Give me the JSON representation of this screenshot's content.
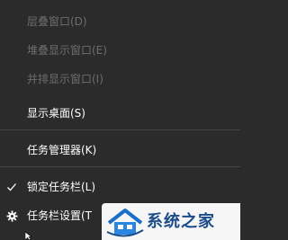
{
  "context_menu": {
    "items": [
      {
        "label": "层叠窗口(D)",
        "enabled": false
      },
      {
        "label": "堆叠显示窗口(E)",
        "enabled": false
      },
      {
        "label": "并排显示窗口(I)",
        "enabled": false
      },
      {
        "label": "显示桌面(S)",
        "enabled": true
      },
      {
        "label": "任务管理器(K)",
        "enabled": true
      },
      {
        "label": "锁定任务栏(L)",
        "enabled": true,
        "checked": true
      },
      {
        "label": "任务栏设置(T",
        "enabled": true,
        "icon": "gear-icon"
      }
    ]
  },
  "watermark": {
    "text": "系统之家"
  },
  "colors": {
    "menu_background": "#2b2b2b",
    "text_enabled": "#ffffff",
    "text_disabled": "#6d6d6d",
    "divider": "#444444",
    "watermark_text": "#1b4c8a"
  }
}
